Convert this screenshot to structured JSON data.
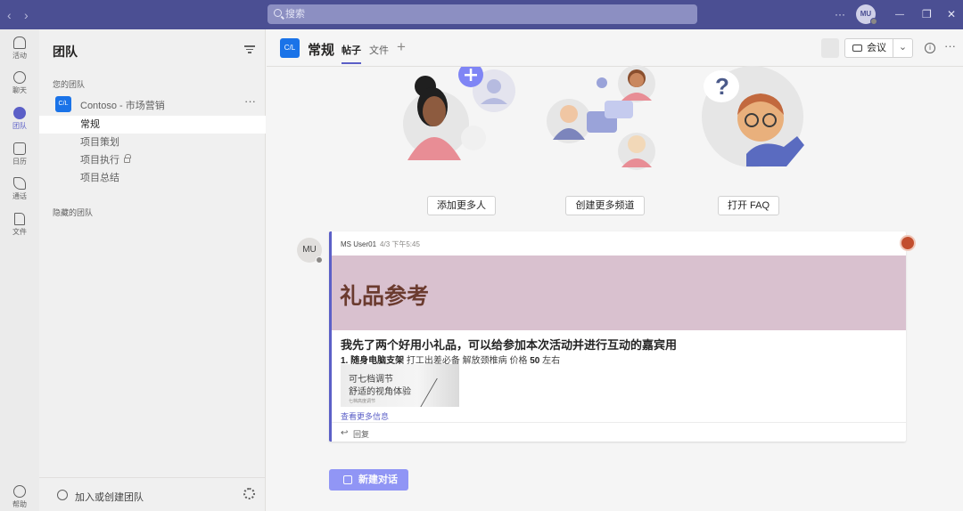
{
  "titlebar": {
    "back_icon": "chevron-left-icon",
    "forward_icon": "chevron-right-icon",
    "search_placeholder": "搜索",
    "more": "···",
    "user_initials": "MU",
    "window_min": "—",
    "window_max": "❐",
    "window_close": "✕"
  },
  "appbar": {
    "items": [
      {
        "label": "活动",
        "icon": "bell-icon"
      },
      {
        "label": "聊天",
        "icon": "chat-icon"
      },
      {
        "label": "团队",
        "icon": "teams-icon"
      },
      {
        "label": "日历",
        "icon": "calendar-icon"
      },
      {
        "label": "通话",
        "icon": "phone-icon"
      },
      {
        "label": "文件",
        "icon": "file-icon"
      }
    ],
    "help": "帮助"
  },
  "sidebar": {
    "title": "团队",
    "your_teams": "您的团队",
    "team": {
      "logo": "C/L",
      "name": "Contoso - 市场营销",
      "more": "···"
    },
    "channels": [
      "常规",
      "项目策划",
      "项目执行",
      "项目总结"
    ],
    "hidden_teams": "隐藏的团队",
    "join_create": "加入或创建团队"
  },
  "channel": {
    "logo": "C/L",
    "name": "常规",
    "tabs": [
      "帖子",
      "文件"
    ],
    "add_tab": "+",
    "meet_label": "会议",
    "meet_dropdown": "⌄",
    "info": "i",
    "more": "···"
  },
  "welcome": {
    "buttons": [
      "添加更多人",
      "创建更多频道",
      "打开 FAQ"
    ]
  },
  "post": {
    "author_initials": "MU",
    "author": "MS User01",
    "time": "4/3 下午5:45",
    "banner_title": "礼品参考",
    "headline": "我先了两个好用小礼品，可以给参加本次活动并进行互动的嘉宾用",
    "item_prefix": "1. 随身电脑支架",
    "item_desc": " 打工出差必备 解放颈椎病 价格 ",
    "item_price": "50",
    "item_suffix": " 左右",
    "img_line1": "可七档调节",
    "img_line2": "舒适的视角体验",
    "img_small": "七档高度调节",
    "see_more": "查看更多信息",
    "reply": "回复"
  },
  "new_conversation": "新建对话",
  "colors": {
    "titlebar": "#4b4f93",
    "accent": "#5b5fc7",
    "banner": "#d9c1cf",
    "banner_text": "#6b3b2f"
  }
}
